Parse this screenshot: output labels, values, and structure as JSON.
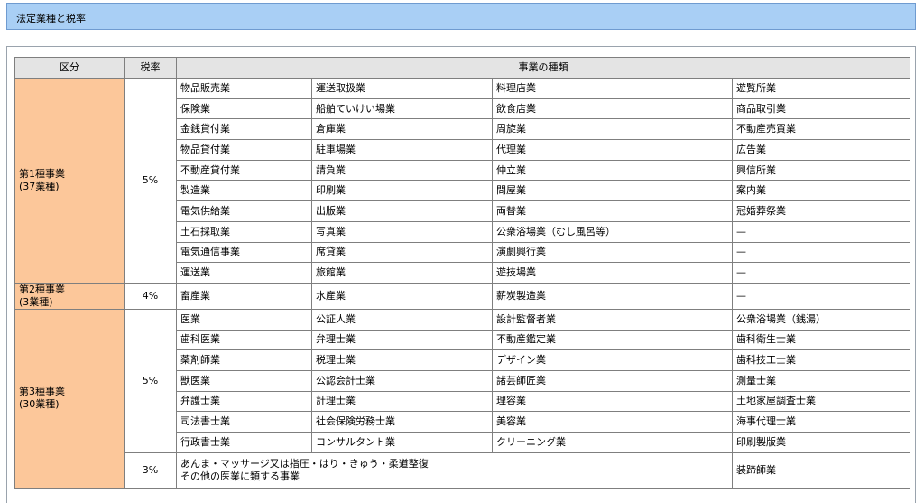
{
  "page": {
    "title": "法定業種と税率"
  },
  "table": {
    "headers": [
      "区分",
      "税率",
      "事業の種類"
    ],
    "groups": [
      {
        "category_line1": "第1種事業",
        "category_line2": "(37業種)",
        "rate": "5%",
        "rows": [
          [
            "物品販売業",
            "運送取扱業",
            "料理店業",
            "遊覧所業"
          ],
          [
            "保険業",
            "船舶ていけい場業",
            "飲食店業",
            "商品取引業"
          ],
          [
            "金銭貸付業",
            "倉庫業",
            "周旋業",
            "不動産売買業"
          ],
          [
            "物品貸付業",
            "駐車場業",
            "代理業",
            "広告業"
          ],
          [
            "不動産貸付業",
            "請負業",
            "仲立業",
            "興信所業"
          ],
          [
            "製造業",
            "印刷業",
            "問屋業",
            "案内業"
          ],
          [
            "電気供給業",
            "出版業",
            "両替業",
            "冠婚葬祭業"
          ],
          [
            "土石採取業",
            "写真業",
            "公衆浴場業（むし風呂等）",
            "—"
          ],
          [
            "電気通信事業",
            "席貸業",
            "演劇興行業",
            "—"
          ],
          [
            "運送業",
            "旅館業",
            "遊技場業",
            "—"
          ]
        ]
      },
      {
        "category_line1": "第2種事業",
        "category_line2": "(3業種)",
        "rate": "4%",
        "rows": [
          [
            "畜産業",
            "水産業",
            "薪炭製造業",
            "—"
          ]
        ]
      },
      {
        "category_line1": "第3種事業",
        "category_line2": "(30業種)",
        "rate": "5%",
        "rows": [
          [
            "医業",
            "公証人業",
            "設計監督者業",
            "公衆浴場業（銭湯）"
          ],
          [
            "歯科医業",
            "弁理士業",
            "不動産鑑定業",
            "歯科衛生士業"
          ],
          [
            "薬剤師業",
            "税理士業",
            "デザイン業",
            "歯科技工士業"
          ],
          [
            "獣医業",
            "公認会計士業",
            "諸芸師匠業",
            "測量士業"
          ],
          [
            "弁護士業",
            "計理士業",
            "理容業",
            "土地家屋調査士業"
          ],
          [
            "司法書士業",
            "社会保険労務士業",
            "美容業",
            "海事代理士業"
          ],
          [
            "行政書士業",
            "コンサルタント業",
            "クリーニング業",
            "印刷製版業"
          ]
        ],
        "sub": {
          "rate": "3%",
          "line1": "あんま・マッサージ又は指圧・はり・きゅう・柔道整復",
          "line2": "その他の医業に類する事業",
          "last": "装蹄師業"
        }
      }
    ]
  }
}
